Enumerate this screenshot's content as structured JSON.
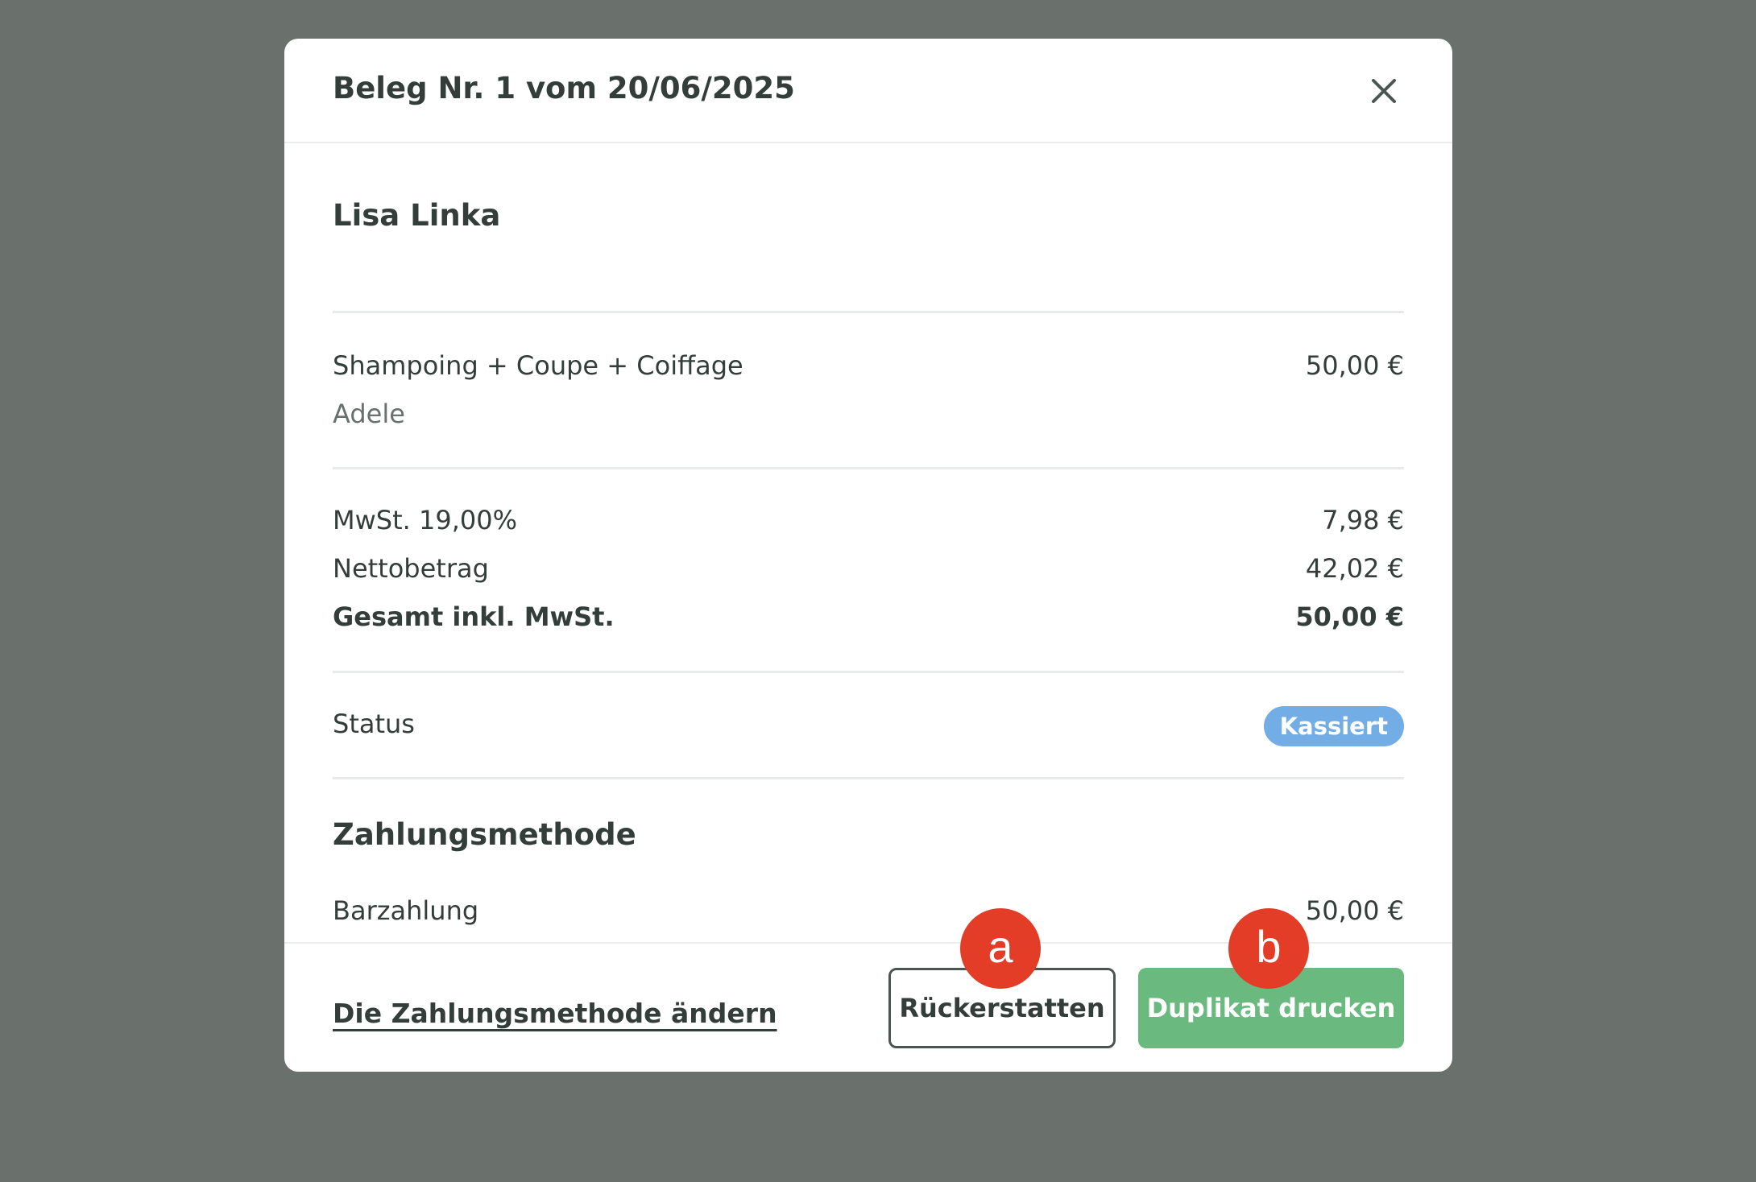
{
  "modal": {
    "title": "Beleg Nr. 1 vom 20/06/2025",
    "close_icon": "close-icon"
  },
  "customer": {
    "name": "Lisa Linka"
  },
  "line_item": {
    "service": "Shampoing + Coupe + Coiffage",
    "price": "50,00 €",
    "staff": "Adele"
  },
  "totals": {
    "vat_label": "MwSt. 19,00%",
    "vat_value": "7,98 €",
    "net_label": "Nettobetrag",
    "net_value": "42,02 €",
    "gross_label": "Gesamt inkl. MwSt.",
    "gross_value": "50,00 €"
  },
  "status": {
    "label": "Status",
    "badge": "Kassiert",
    "badge_color": "#72ade6"
  },
  "payment": {
    "section_title": "Zahlungsmethode",
    "method": "Barzahlung",
    "amount": "50,00 €"
  },
  "footer": {
    "change_link": "Die Zahlungsmethode ändern",
    "refund_button": "Rückerstatten",
    "duplicate_button": "Duplikat drucken",
    "duplicate_color": "#6aba80"
  },
  "annotations": {
    "marker_a": "a",
    "marker_b": "b",
    "marker_color": "#e43d27"
  }
}
